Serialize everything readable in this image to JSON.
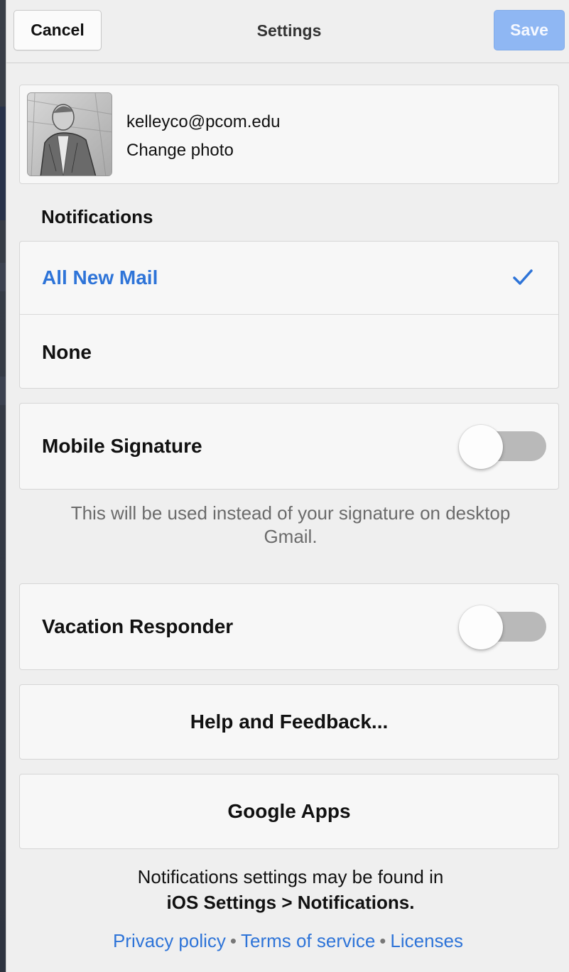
{
  "header": {
    "cancel_label": "Cancel",
    "title": "Settings",
    "save_label": "Save"
  },
  "account": {
    "email": "kelleyco@pcom.edu",
    "change_photo_label": "Change photo"
  },
  "notifications": {
    "section_label": "Notifications",
    "options": [
      {
        "label": "All New Mail",
        "selected": true
      },
      {
        "label": "None",
        "selected": false
      }
    ]
  },
  "mobile_signature": {
    "label": "Mobile Signature",
    "enabled": false,
    "hint": "This will be used instead of your signature on desktop Gmail."
  },
  "vacation_responder": {
    "label": "Vacation Responder",
    "enabled": false
  },
  "actions": {
    "help_label": "Help and Feedback...",
    "google_apps_label": "Google Apps"
  },
  "footer": {
    "note_line1": "Notifications settings may be found in",
    "note_line2": "iOS Settings > Notifications.",
    "links": [
      {
        "label": "Privacy policy"
      },
      {
        "label": "Terms of service"
      },
      {
        "label": "Licenses"
      }
    ],
    "separator": "•"
  },
  "colors": {
    "accent": "#2e74d8",
    "save_disabled": "#8fb7f3",
    "toggle_off": "#b9b9b9"
  }
}
